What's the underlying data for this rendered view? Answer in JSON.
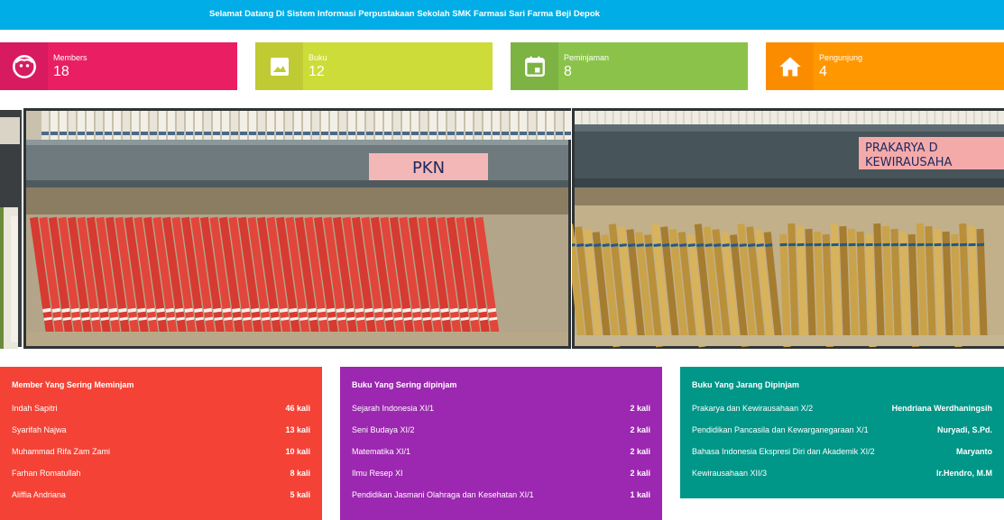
{
  "header": {
    "welcome": "Selamat Datang Di Sistem Informasi Perpustakaan Sekolah SMK Farmasi Sari Farma Beji Depok"
  },
  "stats": [
    {
      "label": "Members",
      "value": "18",
      "icon": "face-icon",
      "color": "#e91e63",
      "icon_bg": "#d81b60"
    },
    {
      "label": "Buku",
      "value": "12",
      "icon": "image-icon",
      "color": "#cddc39",
      "icon_bg": "#c0ca33"
    },
    {
      "label": "Peminjaman",
      "value": "8",
      "icon": "calendar-icon",
      "color": "#8bc34a",
      "icon_bg": "#7cb342"
    },
    {
      "label": "Pengunjung",
      "value": "4",
      "icon": "home-icon",
      "color": "#ff9800",
      "icon_bg": "#fb8c00"
    }
  ],
  "carousel": {
    "shelf_labels": [
      "PKN",
      "PRAKARYA D\nKEWIRAUSAHA"
    ]
  },
  "panels": {
    "members": {
      "title": "Member Yang Sering Meminjam",
      "color": "#f44336",
      "rows": [
        {
          "name": "Indah Sapitri",
          "value": "46 kali"
        },
        {
          "name": "Syarifah Najwa",
          "value": "13 kali"
        },
        {
          "name": "Muhammad Rifa Zam Zami",
          "value": "10 kali"
        },
        {
          "name": "Farhan Romatullah",
          "value": "8 kali"
        },
        {
          "name": "Aliffia Andriana",
          "value": "5 kali"
        }
      ]
    },
    "often": {
      "title": "Buku Yang Sering dipinjam",
      "color": "#9c27b0",
      "rows": [
        {
          "name": "Sejarah Indonesia XI/1",
          "value": "2 kali"
        },
        {
          "name": "Seni Budaya XI/2",
          "value": "2 kali"
        },
        {
          "name": "Matematika XI/1",
          "value": "2 kali"
        },
        {
          "name": "Ilmu Resep XI",
          "value": "2 kali"
        },
        {
          "name": "Pendidikan Jasmani Olahraga dan Kesehatan XI/1",
          "value": "1 kali"
        }
      ]
    },
    "rare": {
      "title": "Buku Yang Jarang Dipinjam",
      "color": "#009688",
      "rows": [
        {
          "name": "Prakarya dan Kewirausahaan X/2",
          "value": "Hendriana Werdhaningsih"
        },
        {
          "name": "Pendidikan Pancasila dan Kewarganegaraan X/1",
          "value": "Nuryadi, S.Pd."
        },
        {
          "name": "Bahasa Indonesia Ekspresi Diri dan Akademik XI/2",
          "value": "Maryanto"
        },
        {
          "name": "Kewirausahaan XII/3",
          "value": "Ir.Hendro, M.M"
        }
      ]
    }
  }
}
